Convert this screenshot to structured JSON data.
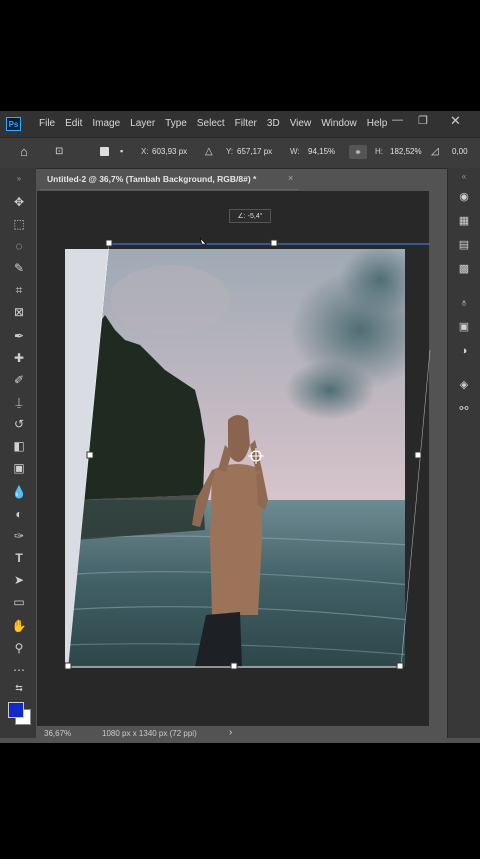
{
  "window": {
    "app_icon": "Ps",
    "menu": [
      "File",
      "Edit",
      "Image",
      "Layer",
      "Type",
      "Select",
      "Filter",
      "3D",
      "View",
      "Window",
      "Help"
    ],
    "controls": {
      "minimize": "—",
      "restore": "❐",
      "close": "✕"
    }
  },
  "options": {
    "x_label": "X:",
    "x_value": "603,93 px",
    "y_label": "Y:",
    "y_value": "657,17 px",
    "w_label": "W:",
    "w_value": "94,15%",
    "h_label": "H:",
    "h_value": "182,52%",
    "rotate_value": "0,00"
  },
  "document": {
    "tab_title": "Untitled-2 @ 36,7% (Tambah Background, RGB/8#) *",
    "tab_close": "×",
    "rotation_readout": "∠: -5,4°"
  },
  "status": {
    "zoom": "36,67%",
    "doc_size": "1080 px x 1340 px (72 ppi)",
    "arrow": "›"
  },
  "colors": {
    "foreground": "#1129c9",
    "background": "#ffffff"
  }
}
